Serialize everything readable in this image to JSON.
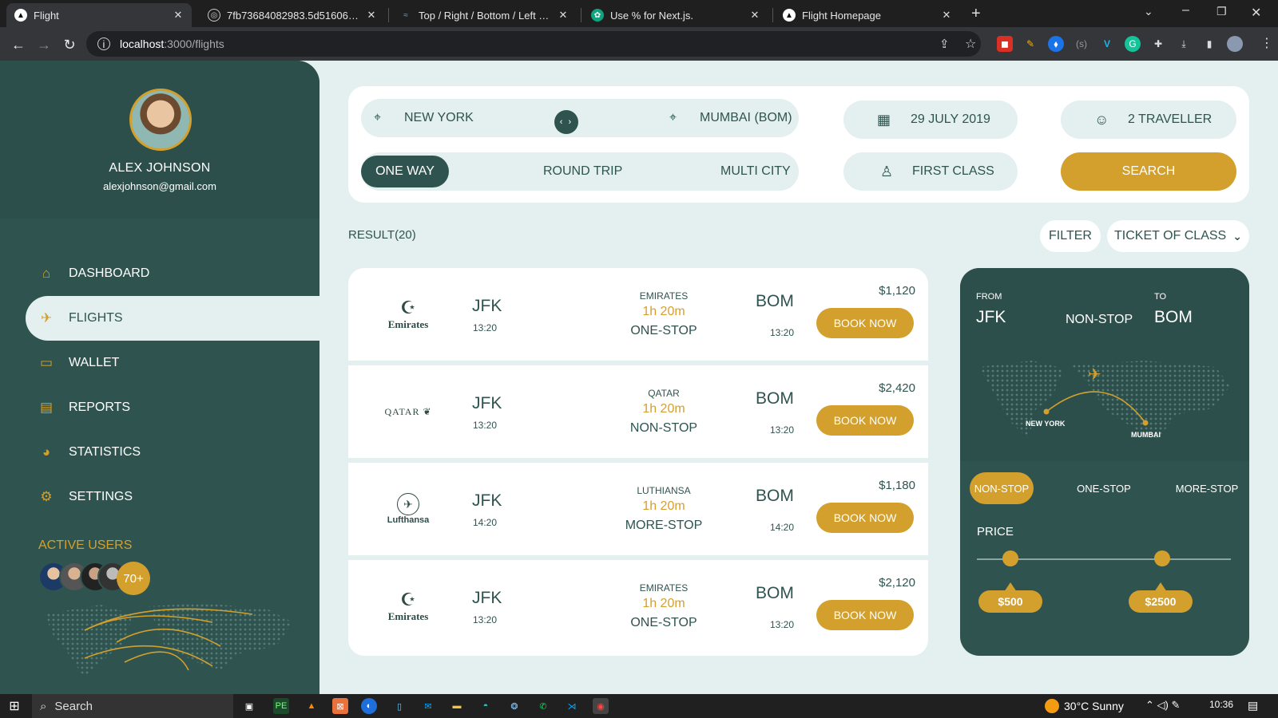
{
  "browser": {
    "tabs": [
      {
        "label": "Flight"
      },
      {
        "label": "7fb73684082983.5d5160618cc9..."
      },
      {
        "label": "Top / Right / Bottom / Left - Tail..."
      },
      {
        "label": "Use % for Next.js."
      },
      {
        "label": "Flight Homepage"
      }
    ],
    "url_host": "localhost",
    "url_path": ":3000/flights"
  },
  "user": {
    "name": "ALEX JOHNSON",
    "email": "alexjohnson@gmail.com"
  },
  "nav": [
    {
      "label": "DASHBOARD",
      "icon": "home-icon"
    },
    {
      "label": "FLIGHTS",
      "icon": "plane-icon"
    },
    {
      "label": "WALLET",
      "icon": "wallet-icon"
    },
    {
      "label": "REPORTS",
      "icon": "reports-icon"
    },
    {
      "label": "STATISTICS",
      "icon": "pie-chart-icon"
    },
    {
      "label": "SETTINGS",
      "icon": "gear-icon"
    }
  ],
  "active_users": {
    "label": "ACTIVE USERS",
    "more": "70+"
  },
  "search": {
    "from": "NEW YORK",
    "to": "MUMBAI (BOM)",
    "date": "29 JULY 2019",
    "travellers": "2 TRAVELLER",
    "trip_types": [
      "ONE WAY",
      "ROUND TRIP",
      "MULTI CITY"
    ],
    "class": "FIRST CLASS",
    "search_label": "SEARCH"
  },
  "results": {
    "label": "RESULT(20)",
    "filter_label": "FILTER",
    "class_label": "TICKET OF CLASS",
    "flights": [
      {
        "logo": "Emirates",
        "from": "JFK",
        "dep": "13:20",
        "airline": "EMIRATES",
        "duration": "1h 20m",
        "stops": "ONE-STOP",
        "to": "BOM",
        "arr": "13:20",
        "price": "$1,120",
        "book": "BOOK NOW"
      },
      {
        "logo": "QATAR",
        "from": "JFK",
        "dep": "13:20",
        "airline": "QATAR",
        "duration": "1h 20m",
        "stops": "NON-STOP",
        "to": "BOM",
        "arr": "13:20",
        "price": "$2,420",
        "book": "BOOK NOW"
      },
      {
        "logo": "Lufthansa",
        "from": "JFK",
        "dep": "14:20",
        "airline": "LUTHIANSA",
        "duration": "1h 20m",
        "stops": "MORE-STOP",
        "to": "BOM",
        "arr": "14:20",
        "price": "$1,180",
        "book": "BOOK NOW"
      },
      {
        "logo": "Emirates",
        "from": "JFK",
        "dep": "13:20",
        "airline": "EMIRATES",
        "duration": "1h 20m",
        "stops": "ONE-STOP",
        "to": "BOM",
        "arr": "13:20",
        "price": "$2,120",
        "book": "BOOK NOW"
      }
    ]
  },
  "route_panel": {
    "from_label": "FROM",
    "from": "JFK",
    "to_label": "TO",
    "to": "BOM",
    "mode": "NON-STOP",
    "map_from": "NEW YORK",
    "map_to": "MUMBAI",
    "stop_options": [
      "NON-STOP",
      "ONE-STOP",
      "MORE-STOP"
    ],
    "price_label": "PRICE",
    "price_min": "$500",
    "price_max": "$2500"
  },
  "taskbar": {
    "search": "Search",
    "weather": "30°C  Sunny",
    "time": "10:36"
  },
  "colors": {
    "primary": "#2f5450",
    "accent": "#d4a02d",
    "background": "#e3f0ef"
  }
}
